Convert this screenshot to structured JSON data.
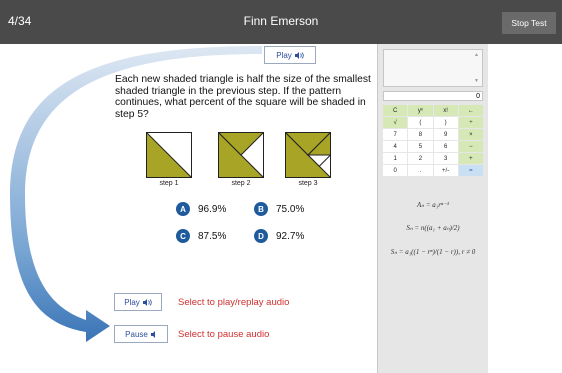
{
  "header": {
    "counter": "4/34",
    "student_name": "Finn Emerson",
    "stop_button": "Stop Test"
  },
  "question": {
    "play_label": "Play",
    "text": "Each new shaded triangle is half the size of the smallest shaded triangle in the previous step. If the pattern continues, what percent of the square will be shaded in step 5?",
    "steps": [
      "step 1",
      "step 2",
      "step 3"
    ],
    "shade_color": "#a8a426"
  },
  "choices": [
    {
      "letter": "A",
      "value": "96.9%"
    },
    {
      "letter": "B",
      "value": "75.0%"
    },
    {
      "letter": "C",
      "value": "87.5%"
    },
    {
      "letter": "D",
      "value": "92.7%"
    }
  ],
  "audio": {
    "play_label": "Play",
    "play_hint": "Select to play/replay audio",
    "pause_label": "Pause",
    "pause_hint": "Select to pause audio"
  },
  "calculator": {
    "display": "0",
    "keys": [
      {
        "label": "C",
        "style": "g"
      },
      {
        "label": "yˣ",
        "style": "g"
      },
      {
        "label": "x!",
        "style": "g"
      },
      {
        "label": "←",
        "style": "g"
      },
      {
        "label": "√",
        "style": "g"
      },
      {
        "label": "(",
        "style": "w"
      },
      {
        "label": ")",
        "style": "w"
      },
      {
        "label": "÷",
        "style": "g"
      },
      {
        "label": "7",
        "style": "w"
      },
      {
        "label": "8",
        "style": "w"
      },
      {
        "label": "9",
        "style": "w"
      },
      {
        "label": "×",
        "style": "g"
      },
      {
        "label": "4",
        "style": "w"
      },
      {
        "label": "5",
        "style": "w"
      },
      {
        "label": "6",
        "style": "w"
      },
      {
        "label": "−",
        "style": "g"
      },
      {
        "label": "1",
        "style": "w"
      },
      {
        "label": "2",
        "style": "w"
      },
      {
        "label": "3",
        "style": "w"
      },
      {
        "label": "+",
        "style": "g"
      },
      {
        "label": "0",
        "style": "w"
      },
      {
        "label": ".",
        "style": "w"
      },
      {
        "label": "+/-",
        "style": "w"
      },
      {
        "label": "=",
        "style": "b"
      }
    ],
    "formulas": [
      "Aₙ = a₁rⁿ⁻¹",
      "Sₙ = n((a₁ + aₙ)/2)",
      "Sₙ = a₁((1 − rⁿ)/(1 − r)), r ≠ 0"
    ]
  },
  "colors": {
    "header_bg": "#4a4a4a",
    "badge": "#1f5a9c",
    "arrow": "#2f6db2",
    "hint_text": "#d03030"
  }
}
